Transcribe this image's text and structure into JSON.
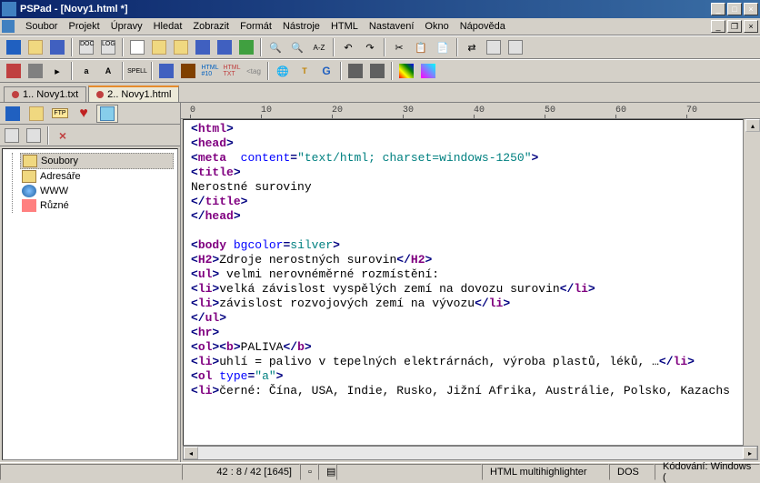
{
  "title": "PSPad - [Novy1.html *]",
  "menu": [
    "Soubor",
    "Projekt",
    "Úpravy",
    "Hledat",
    "Zobrazit",
    "Formát",
    "Nástroje",
    "HTML",
    "Nastavení",
    "Okno",
    "Nápověda"
  ],
  "tabs": [
    {
      "label": "1.. Novy1.txt",
      "active": false
    },
    {
      "label": "2.. Novy1.html",
      "active": true
    }
  ],
  "tree": [
    {
      "label": "Soubory",
      "icon": "folder",
      "selected": true
    },
    {
      "label": "Adresáře",
      "icon": "folder",
      "selected": false
    },
    {
      "label": "WWW",
      "icon": "globe",
      "selected": false
    },
    {
      "label": "Různé",
      "icon": "misc",
      "selected": false
    }
  ],
  "ruler_marks": [
    "0",
    "10",
    "20",
    "30",
    "40",
    "50",
    "60",
    "70"
  ],
  "code_lines": [
    {
      "type": "tag",
      "tokens": [
        {
          "t": "<",
          "c": "tag"
        },
        {
          "t": "html",
          "c": "tagname"
        },
        {
          "t": ">",
          "c": "tag"
        }
      ]
    },
    {
      "type": "tag",
      "tokens": [
        {
          "t": "<",
          "c": "tag"
        },
        {
          "t": "head",
          "c": "tagname"
        },
        {
          "t": ">",
          "c": "tag"
        }
      ]
    },
    {
      "type": "tag",
      "tokens": [
        {
          "t": "<",
          "c": "tag"
        },
        {
          "t": "meta",
          "c": "tagname"
        },
        {
          "t": "  ",
          "c": "txt"
        },
        {
          "t": "content",
          "c": "attr"
        },
        {
          "t": "=",
          "c": "tag"
        },
        {
          "t": "\"text/html; charset=windows-1250\"",
          "c": "attrval"
        },
        {
          "t": ">",
          "c": "tag"
        }
      ]
    },
    {
      "type": "tag",
      "tokens": [
        {
          "t": "<",
          "c": "tag"
        },
        {
          "t": "title",
          "c": "tagname"
        },
        {
          "t": ">",
          "c": "tag"
        }
      ]
    },
    {
      "type": "text",
      "tokens": [
        {
          "t": "Nerostné suroviny",
          "c": "txt"
        }
      ]
    },
    {
      "type": "tag",
      "tokens": [
        {
          "t": "</",
          "c": "tag"
        },
        {
          "t": "title",
          "c": "tagname"
        },
        {
          "t": ">",
          "c": "tag"
        }
      ]
    },
    {
      "type": "tag",
      "tokens": [
        {
          "t": "</",
          "c": "tag"
        },
        {
          "t": "head",
          "c": "tagname"
        },
        {
          "t": ">",
          "c": "tag"
        }
      ]
    },
    {
      "type": "blank",
      "tokens": []
    },
    {
      "type": "tag",
      "tokens": [
        {
          "t": "<",
          "c": "tag"
        },
        {
          "t": "body",
          "c": "tagname"
        },
        {
          "t": " ",
          "c": "txt"
        },
        {
          "t": "bgcolor",
          "c": "attr"
        },
        {
          "t": "=",
          "c": "tag"
        },
        {
          "t": "silver",
          "c": "attrval"
        },
        {
          "t": ">",
          "c": "tag"
        }
      ]
    },
    {
      "type": "tag",
      "tokens": [
        {
          "t": "<",
          "c": "tag"
        },
        {
          "t": "H2",
          "c": "tagname"
        },
        {
          "t": ">",
          "c": "tag"
        },
        {
          "t": "Zdroje nerostných surovin",
          "c": "txt"
        },
        {
          "t": "</",
          "c": "tag"
        },
        {
          "t": "H2",
          "c": "tagname"
        },
        {
          "t": ">",
          "c": "tag"
        }
      ]
    },
    {
      "type": "tag",
      "tokens": [
        {
          "t": "<",
          "c": "tag"
        },
        {
          "t": "ul",
          "c": "tagname"
        },
        {
          "t": ">",
          "c": "tag"
        },
        {
          "t": " velmi nerovnéměrné rozmístění:",
          "c": "txt"
        }
      ]
    },
    {
      "type": "tag",
      "tokens": [
        {
          "t": "<",
          "c": "tag"
        },
        {
          "t": "li",
          "c": "tagname"
        },
        {
          "t": ">",
          "c": "tag"
        },
        {
          "t": "velká závislost vyspělých zemí na dovozu surovin",
          "c": "txt"
        },
        {
          "t": "</",
          "c": "tag"
        },
        {
          "t": "li",
          "c": "tagname"
        },
        {
          "t": ">",
          "c": "tag"
        }
      ]
    },
    {
      "type": "tag",
      "tokens": [
        {
          "t": "<",
          "c": "tag"
        },
        {
          "t": "li",
          "c": "tagname"
        },
        {
          "t": ">",
          "c": "tag"
        },
        {
          "t": "závislost rozvojových zemí na vývozu",
          "c": "txt"
        },
        {
          "t": "</",
          "c": "tag"
        },
        {
          "t": "li",
          "c": "tagname"
        },
        {
          "t": ">",
          "c": "tag"
        }
      ]
    },
    {
      "type": "tag",
      "tokens": [
        {
          "t": "</",
          "c": "tag"
        },
        {
          "t": "ul",
          "c": "tagname"
        },
        {
          "t": ">",
          "c": "tag"
        }
      ]
    },
    {
      "type": "tag",
      "tokens": [
        {
          "t": "<",
          "c": "tag"
        },
        {
          "t": "hr",
          "c": "tagname"
        },
        {
          "t": ">",
          "c": "tag"
        }
      ]
    },
    {
      "type": "tag",
      "tokens": [
        {
          "t": "<",
          "c": "tag"
        },
        {
          "t": "ol",
          "c": "tagname"
        },
        {
          "t": ">",
          "c": "tag"
        },
        {
          "t": "<",
          "c": "tag"
        },
        {
          "t": "b",
          "c": "tagname"
        },
        {
          "t": ">",
          "c": "tag"
        },
        {
          "t": "PALIVA",
          "c": "txt"
        },
        {
          "t": "</",
          "c": "tag"
        },
        {
          "t": "b",
          "c": "tagname"
        },
        {
          "t": ">",
          "c": "tag"
        }
      ]
    },
    {
      "type": "tag",
      "tokens": [
        {
          "t": "<",
          "c": "tag"
        },
        {
          "t": "li",
          "c": "tagname"
        },
        {
          "t": ">",
          "c": "tag"
        },
        {
          "t": "uhlí = palivo v tepelných elektrárnách, výroba plastů, léků, …",
          "c": "txt"
        },
        {
          "t": "</",
          "c": "tag"
        },
        {
          "t": "li",
          "c": "tagname"
        },
        {
          "t": ">",
          "c": "tag"
        }
      ]
    },
    {
      "type": "tag",
      "tokens": [
        {
          "t": "<",
          "c": "tag"
        },
        {
          "t": "ol",
          "c": "tagname"
        },
        {
          "t": " ",
          "c": "txt"
        },
        {
          "t": "type",
          "c": "attr"
        },
        {
          "t": "=",
          "c": "tag"
        },
        {
          "t": "\"a\"",
          "c": "attrval"
        },
        {
          "t": ">",
          "c": "tag"
        }
      ]
    },
    {
      "type": "tag",
      "tokens": [
        {
          "t": "<",
          "c": "tag"
        },
        {
          "t": "li",
          "c": "tagname"
        },
        {
          "t": ">",
          "c": "tag"
        },
        {
          "t": "černé: Čína, USA, Indie, Rusko, Jižní Afrika, Austrálie, Polsko, Kazachs",
          "c": "txt"
        }
      ]
    }
  ],
  "status": {
    "pos": "42 : 8 / 42  [1645]",
    "highlighter": "HTML multihighlighter",
    "lineend": "DOS",
    "encoding": "Kódování: Windows ("
  }
}
